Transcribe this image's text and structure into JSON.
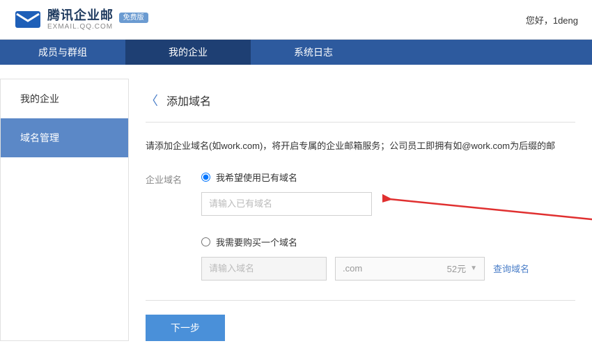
{
  "header": {
    "brand_main": "腾讯企业邮",
    "brand_sub": "EXMAIL.QQ.COM",
    "badge": "免费版",
    "greeting_prefix": "您好，",
    "user": "1deng"
  },
  "topnav": {
    "items": [
      {
        "label": "成员与群组"
      },
      {
        "label": "我的企业"
      },
      {
        "label": "系统日志"
      }
    ],
    "active_index": 1
  },
  "sidebar": {
    "items": [
      {
        "label": "我的企业"
      },
      {
        "label": "域名管理"
      }
    ],
    "active_index": 1
  },
  "page": {
    "title": "添加域名",
    "instruction": "请添加企业域名(如work.com)，将开启专属的企业邮箱服务；公司员工即拥有如@work.com为后缀的邮"
  },
  "form": {
    "label": "企业域名",
    "option_existing": "我希望使用已有域名",
    "existing_placeholder": "请输入已有域名",
    "option_buy": "我需要购买一个域名",
    "buy_placeholder": "请输入域名",
    "tld": ".com",
    "tld_price": "52元",
    "lookup": "查询域名",
    "selected": "existing"
  },
  "actions": {
    "next": "下一步"
  }
}
